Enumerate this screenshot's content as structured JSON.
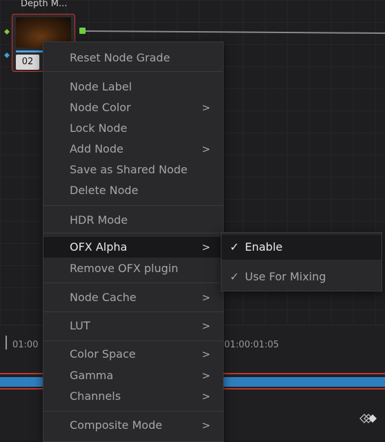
{
  "node_editor": {
    "node_title": "Depth M...",
    "node_number": "02"
  },
  "context_menu": {
    "items": [
      {
        "label": "Reset Node Grade",
        "arrow": ""
      },
      {
        "label": "Node Label",
        "arrow": ""
      },
      {
        "label": "Node Color",
        "arrow": ">"
      },
      {
        "label": "Lock Node",
        "arrow": ""
      },
      {
        "label": "Add Node",
        "arrow": ">"
      },
      {
        "label": "Save as Shared Node",
        "arrow": ""
      },
      {
        "label": "Delete Node",
        "arrow": ""
      },
      {
        "label": "HDR Mode",
        "arrow": ""
      },
      {
        "label": "OFX Alpha",
        "arrow": ">"
      },
      {
        "label": "Remove OFX plugin",
        "arrow": ""
      },
      {
        "label": "Node Cache",
        "arrow": ">"
      },
      {
        "label": "LUT",
        "arrow": ">"
      },
      {
        "label": "Color Space",
        "arrow": ">"
      },
      {
        "label": "Gamma",
        "arrow": ">"
      },
      {
        "label": "Channels",
        "arrow": ">"
      },
      {
        "label": "Composite Mode",
        "arrow": ">"
      }
    ]
  },
  "submenu": {
    "items": [
      {
        "label": "Enable",
        "check": "✓"
      },
      {
        "label": "Use For Mixing",
        "check": "✓"
      }
    ]
  },
  "timeline": {
    "timecode_left": "01:00",
    "timecode_right": "01:00:01:05"
  },
  "colors": {
    "node_border": "#d0342c",
    "output_port": "#6fd13c",
    "track_blue": "#2f7fc0",
    "track_red": "#c0392b"
  }
}
